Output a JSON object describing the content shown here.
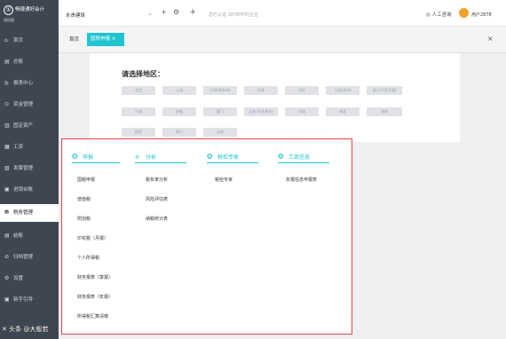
{
  "app": {
    "logo_glyph": "①",
    "logo_name": "畅捷通好会计",
    "logo_sub": "轻松版",
    "company": "永贵建筑",
    "notice": "您已认证 2878HF的企业",
    "support": "人工咨询",
    "user": "用户2878"
  },
  "sidebar": [
    {
      "label": "首页",
      "icon": "⌂"
    },
    {
      "label": "总账",
      "icon": "▤"
    },
    {
      "label": "报表中心",
      "icon": "⊵"
    },
    {
      "label": "资金管理",
      "icon": "⊙"
    },
    {
      "label": "固定资产",
      "icon": "▥"
    },
    {
      "label": "工资",
      "icon": "▦"
    },
    {
      "label": "发票管理",
      "icon": "▧"
    },
    {
      "label": "进销台账",
      "icon": "▣"
    },
    {
      "label": "税务管理",
      "icon": "⛃"
    },
    {
      "label": "结账",
      "icon": "▤"
    },
    {
      "label": "归档管理",
      "icon": "⊘"
    },
    {
      "label": "设置",
      "icon": "⚙"
    },
    {
      "label": "新手引导",
      "icon": "▣"
    }
  ],
  "tabs": {
    "home": "首页",
    "active": "国税申报",
    "close": "×",
    "window_close": "×"
  },
  "region": {
    "title": "请选择地区：",
    "buttons": [
      [
        "北京",
        "上海",
        "江苏(除苏州)",
        "天津",
        "河北",
        "江苏(苏州)",
        "浙江(不含宁波)"
      ],
      [
        "宁波",
        "安徽",
        "厦门",
        "山东(不含青岛)",
        "河南",
        "湖北",
        "湖南"
      ],
      [
        "陕西",
        "四川",
        "云南"
      ]
    ]
  },
  "menu": {
    "categories": [
      {
        "label": "申报",
        "icon": "❂",
        "items": [
          "国税申报",
          "增值税",
          "附加税",
          "印花税（月报）",
          "个人所得税",
          "财务报表（季报）",
          "财务报表（年报）",
          "所得税汇算清缴"
        ]
      },
      {
        "label": "分析",
        "icon": "⟡",
        "items": [
          "税负率分析",
          "风险评估表",
          "纳税统计表"
        ]
      },
      {
        "label": "税检专家",
        "icon": "❂",
        "items": [
          "税检专家"
        ]
      },
      {
        "label": "工商信息",
        "icon": "❂",
        "items": [
          "年报信息申报表"
        ]
      }
    ]
  },
  "watermark": "✕ 头条 @大般若"
}
